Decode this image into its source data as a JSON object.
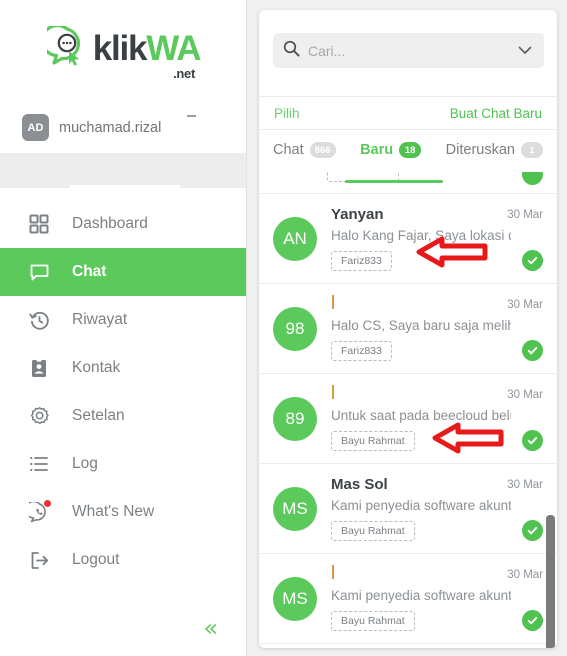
{
  "brand": {
    "name_dark": "klik",
    "name_green": "WA",
    "suffix": ".net",
    "logo_icon": "whatsapp-chat-cursor-logo"
  },
  "user": {
    "badge": "AD",
    "name": "muchamad.rizal",
    "minimize_glyph": "–"
  },
  "sidebar": {
    "collapse_glyph": "«",
    "items": [
      {
        "label": "Dashboard",
        "icon": "grid-icon",
        "active": false,
        "badge_dot": false
      },
      {
        "label": "Chat",
        "icon": "chat-bubble-icon",
        "active": true,
        "badge_dot": false
      },
      {
        "label": "Riwayat",
        "icon": "history-clock-icon",
        "active": false,
        "badge_dot": false
      },
      {
        "label": "Kontak",
        "icon": "contact-card-icon",
        "active": false,
        "badge_dot": false
      },
      {
        "label": "Setelan",
        "icon": "gear-icon",
        "active": false,
        "badge_dot": false
      },
      {
        "label": "Log",
        "icon": "list-icon",
        "active": false,
        "badge_dot": false
      },
      {
        "label": "What's New",
        "icon": "whatsapp-icon",
        "active": false,
        "badge_dot": true
      },
      {
        "label": "Logout",
        "icon": "logout-icon",
        "active": false,
        "badge_dot": false
      }
    ]
  },
  "search": {
    "placeholder": "Cari...",
    "value": "",
    "icon": "search-icon",
    "caret_icon": "chevron-down-icon"
  },
  "actions": {
    "select_label": "Pilih",
    "new_chat_label": "Buat Chat Baru"
  },
  "tabs": [
    {
      "label": "Chat",
      "badge": "866",
      "active": false
    },
    {
      "label": "Baru",
      "badge": "18",
      "active": true
    },
    {
      "label": "Diteruskan",
      "badge": "1",
      "active": false
    }
  ],
  "chat_list": [
    {
      "avatar": "AN",
      "name": "Yanyan",
      "has_name": true,
      "date": "30 Mar",
      "message": "Halo Kang Fajar, Saya lokasi di ...",
      "tag": "Fariz833",
      "status": "delivered-check",
      "arrow": true
    },
    {
      "avatar": "98",
      "name": "",
      "has_name": false,
      "date": "30 Mar",
      "message": "Halo CS, Saya baru saja melihat...",
      "tag": "Fariz833",
      "status": "delivered-check",
      "arrow": false
    },
    {
      "avatar": "89",
      "name": "",
      "has_name": false,
      "date": "30 Mar",
      "message": "Untuk saat pada beecloud belu...",
      "tag": "Bayu Rahmat",
      "status": "delivered-check",
      "arrow": true
    },
    {
      "avatar": "MS",
      "name": "Mas Sol",
      "has_name": true,
      "date": "30 Mar",
      "message": "Kami penyedia software akuntan...",
      "tag": "Bayu Rahmat",
      "status": "delivered-check",
      "arrow": false
    },
    {
      "avatar": "MS",
      "name": "",
      "has_name": false,
      "date": "30 Mar",
      "message": "Kami penyedia software akuntan...",
      "tag": "Bayu Rahmat",
      "status": "delivered-check",
      "arrow": false
    }
  ],
  "colors": {
    "brand_green": "#5cc95c",
    "badge_green": "#4fc24f",
    "muted_gray": "#8c9196",
    "annotation_red": "#e8191b",
    "notification_red": "#ef2f2f",
    "panel_bg": "#f0f0f0"
  },
  "annotations": {
    "arrow_icon": "left-arrow-annotation",
    "count": 2
  }
}
